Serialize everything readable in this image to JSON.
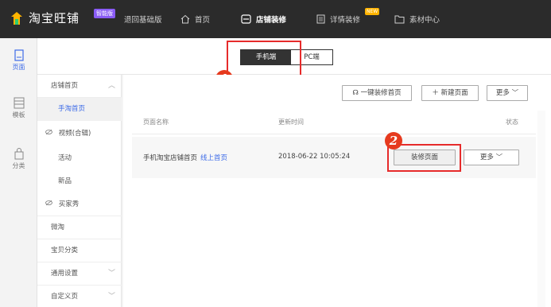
{
  "topbar": {
    "logo_text": "淘宝旺铺",
    "smart_badge": "智能版",
    "back_label": "退回基础版",
    "home_label": "首页",
    "shop_decor_label": "店铺装修",
    "detail_decor_label": "详情装修",
    "new_badge": "NEW",
    "material_label": "素材中心"
  },
  "rail": {
    "items": [
      {
        "label": "页面",
        "icon": "page-icon"
      },
      {
        "label": "模板",
        "icon": "template-icon"
      },
      {
        "label": "分类",
        "icon": "category-icon"
      }
    ]
  },
  "tabs": {
    "mobile": "手机端",
    "pc": "PC端"
  },
  "annotations": {
    "step1": "1",
    "step2": "2"
  },
  "menu": {
    "items": [
      {
        "label": "店铺首页",
        "chevron": "︿"
      },
      {
        "label": "手淘首页"
      },
      {
        "label": "视频(合辑)"
      },
      {
        "label": "活动"
      },
      {
        "label": "新品"
      },
      {
        "label": "买家秀"
      },
      {
        "label": "微淘"
      },
      {
        "label": "宝贝分类"
      },
      {
        "label": "通用设置",
        "chevron": "﹀"
      },
      {
        "label": "自定义页",
        "chevron": "﹀"
      }
    ]
  },
  "toolbar": {
    "one_click_label": "一键装修首页",
    "new_page_label": "新建页面",
    "more_label": "更多"
  },
  "table": {
    "headers": {
      "name": "页面名称",
      "updated": "更新时间",
      "status": "状态"
    },
    "rows": [
      {
        "name": "手机淘宝店铺首页",
        "link": "线上首页",
        "updated": "2018-06-22 10:05:24",
        "decor_button": "装修页面",
        "more_button": "更多"
      }
    ]
  },
  "colors": {
    "accent": "#3d6be8",
    "highlight_red": "#e62b2b",
    "topbar_bg": "#2b2b2b"
  }
}
